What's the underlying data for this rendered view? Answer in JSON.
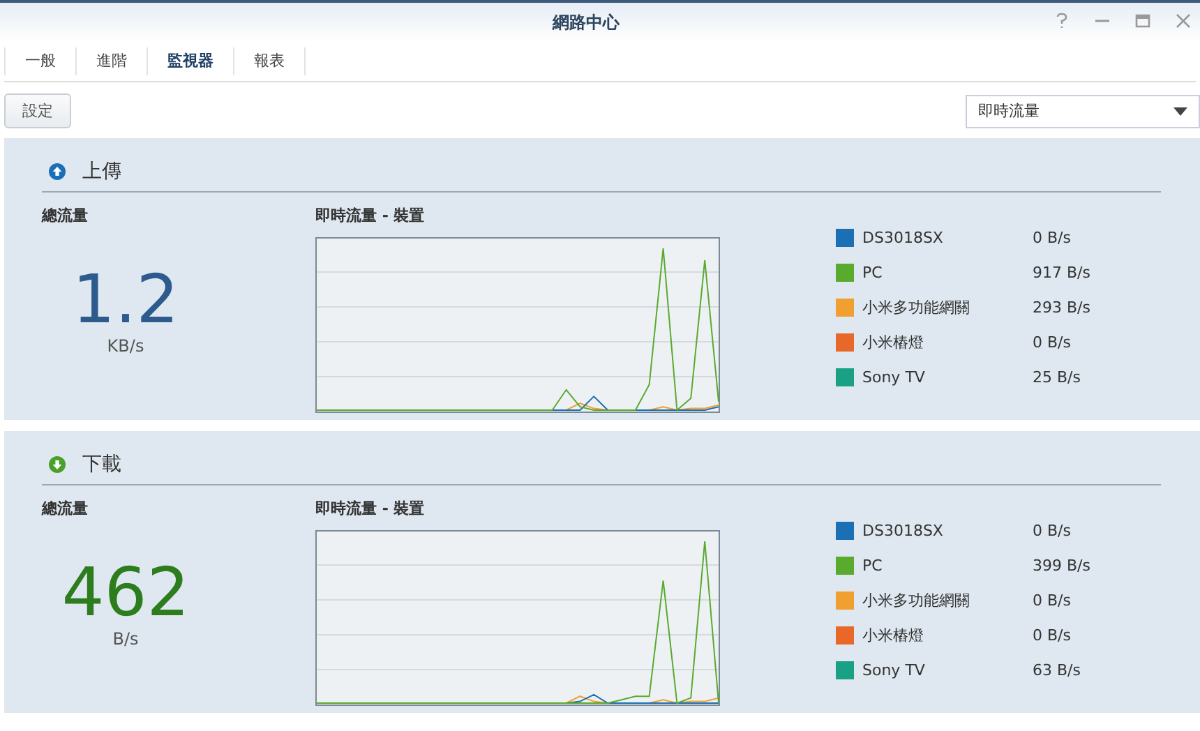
{
  "window": {
    "title": "網路中心"
  },
  "tabs": [
    {
      "label": "一般",
      "selected": false
    },
    {
      "label": "進階",
      "selected": false
    },
    {
      "label": "監視器",
      "selected": true
    },
    {
      "label": "報表",
      "selected": false
    }
  ],
  "toolbar": {
    "button": "設定",
    "dropdown": "即時流量"
  },
  "sections": [
    {
      "kind": "upload",
      "title": "上傳",
      "total_label": "總流量",
      "total": "1.2",
      "unit": "KB/s",
      "chart_label": "即時流量 - 裝置",
      "devices": [
        {
          "name": "DS3018SX",
          "rate": "0 B/s",
          "color": "#1a6fb5"
        },
        {
          "name": "PC",
          "rate": "917 B/s",
          "color": "#5aaa2e"
        },
        {
          "name": "小米多功能網關",
          "rate": "293 B/s",
          "color": "#f0a030"
        },
        {
          "name": "小米樁燈",
          "rate": "0 B/s",
          "color": "#e8682a"
        },
        {
          "name": "Sony TV",
          "rate": "25 B/s",
          "color": "#1aa085"
        }
      ]
    },
    {
      "kind": "download",
      "title": "下載",
      "total_label": "總流量",
      "total": "462",
      "unit": "B/s",
      "chart_label": "即時流量 - 裝置",
      "devices": [
        {
          "name": "DS3018SX",
          "rate": "0 B/s",
          "color": "#1a6fb5"
        },
        {
          "name": "PC",
          "rate": "399 B/s",
          "color": "#5aaa2e"
        },
        {
          "name": "小米多功能網關",
          "rate": "0 B/s",
          "color": "#f0a030"
        },
        {
          "name": "小米樁燈",
          "rate": "0 B/s",
          "color": "#e8682a"
        },
        {
          "name": "Sony TV",
          "rate": "63 B/s",
          "color": "#1aa085"
        }
      ]
    }
  ]
}
